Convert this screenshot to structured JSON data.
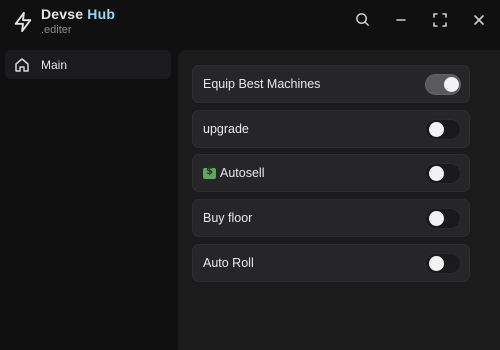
{
  "app": {
    "title_main": "Devse",
    "title_accent": "Hub",
    "subtitle": ".editer"
  },
  "titlebar": {
    "icons": [
      "search-icon",
      "minimize-icon",
      "maximize-icon",
      "close-icon"
    ]
  },
  "sidebar": {
    "items": [
      {
        "label": "Main",
        "icon": "home-icon",
        "selected": true
      }
    ]
  },
  "toggles": [
    {
      "label": "Equip Best Machines",
      "on": true
    },
    {
      "label": "upgrade",
      "on": false
    },
    {
      "label": "Autosell",
      "on": false,
      "icon": "money-emoji"
    },
    {
      "label": "Buy floor",
      "on": false
    },
    {
      "label": "Auto Roll",
      "on": false
    }
  ],
  "colors": {
    "background": "#101011",
    "panel": "#1b1b1c",
    "row": "#262628",
    "accent": "#9fd7ee"
  }
}
